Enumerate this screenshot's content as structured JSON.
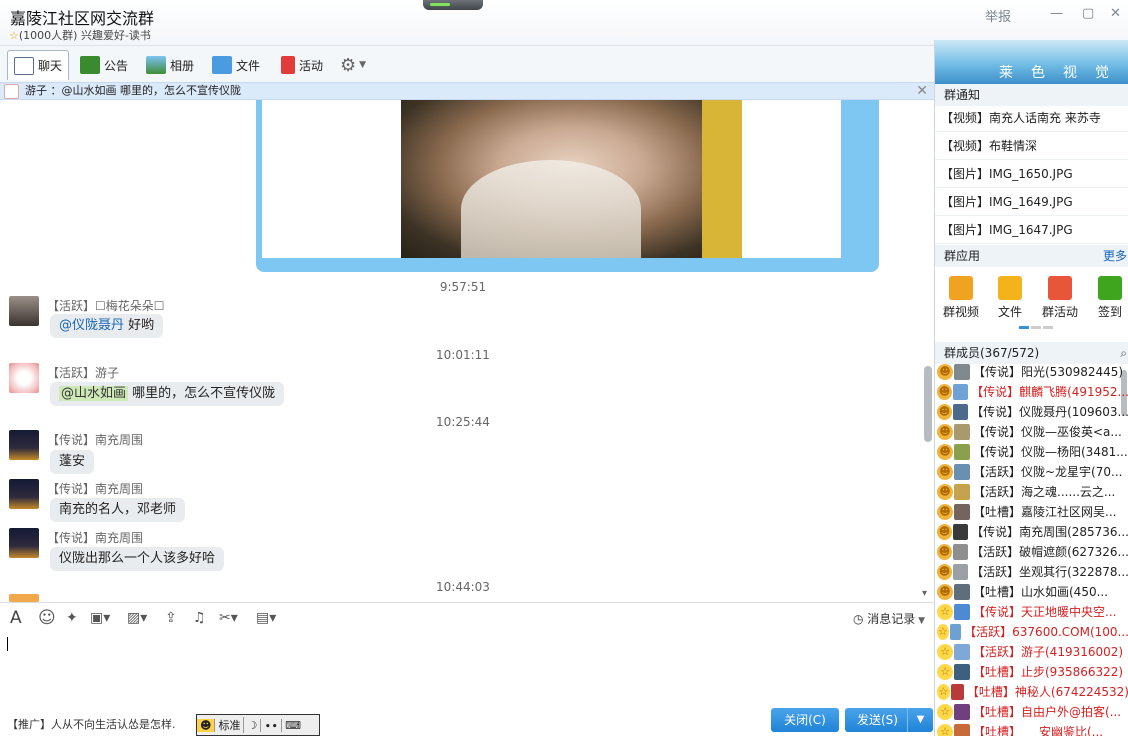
{
  "window": {
    "title": "嘉陵江社区网交流群",
    "subtitle_star": "☆",
    "subtitle": "(1000人群) 兴趣爱好-读书",
    "report": "举报",
    "min": "—",
    "max": "▢",
    "close": "✕"
  },
  "tabs": [
    {
      "label": "聊天"
    },
    {
      "label": "公告"
    },
    {
      "label": "相册"
    },
    {
      "label": "文件"
    },
    {
      "label": "活动"
    }
  ],
  "notice": {
    "text": "游子 ：@山水如画 哪里的，怎么不宣传仪陇",
    "close": "✕"
  },
  "chat": {
    "times": [
      "9:57:51",
      "10:01:11",
      "10:25:44",
      "10:44:03"
    ],
    "messages": [
      {
        "nick": "【活跃】☐梅花朵朵☐",
        "at": "@仪陇聂丹",
        "text": " 好哟"
      },
      {
        "nick": "【活跃】游子",
        "at": "@山水如画",
        "text": " 哪里的，怎么不宣传仪陇"
      },
      {
        "nick": "【传说】南充周围",
        "text": "蓬安"
      },
      {
        "nick": "【传说】南充周围",
        "text": "南充的名人，邓老师"
      },
      {
        "nick": "【传说】南充周围",
        "text": "仪陇出那么一个人该多好哈"
      }
    ]
  },
  "input": {
    "history": "消息记录",
    "font": "A",
    "emoji": "☺"
  },
  "bottom": {
    "promo": "【推广】人从不向生活认怂是怎样.",
    "ime": [
      "标准",
      "☽",
      "∙∙",
      "⌨"
    ],
    "close": "关闭(C)",
    "send": "发送(S)",
    "send_dd": "▼"
  },
  "sidebar": {
    "banner": "莱色视觉",
    "notice_title": "群通知",
    "notices": [
      "【视频】南充人话南充 来苏寺",
      "【视频】布鞋情深",
      "【图片】IMG_1650.JPG",
      "【图片】IMG_1649.JPG",
      "【图片】IMG_1647.JPG"
    ],
    "apps_title": "群应用",
    "apps_more": "更多",
    "apps": [
      {
        "label": "群视频",
        "color": "#f0a320"
      },
      {
        "label": "文件",
        "color": "#f4b21c"
      },
      {
        "label": "群活动",
        "color": "#e8563a"
      },
      {
        "label": "签到",
        "color": "#3fa51f"
      }
    ],
    "members_title": "群成员(367/572)",
    "members": [
      {
        "name": "【传说】阳光(530982445)",
        "color": "#222"
      },
      {
        "name": "【传说】麒麟飞腾(491952...",
        "color": "#d42020"
      },
      {
        "name": "【传说】仪陇聂丹(109603...",
        "color": "#222"
      },
      {
        "name": "【传说】仪陇—巫俊英<a...",
        "color": "#222"
      },
      {
        "name": "【传说】仪陇—杨阳(3481...",
        "color": "#222"
      },
      {
        "name": "【活跃】仪陇~龙星宇(70...",
        "color": "#222"
      },
      {
        "name": "【活跃】海之魂......云之...",
        "color": "#222"
      },
      {
        "name": "【吐槽】嘉陵江社区网吴...",
        "color": "#222"
      },
      {
        "name": "【传说】南充周围(285736...",
        "color": "#222"
      },
      {
        "name": "【活跃】破帽遮颜(627326...",
        "color": "#222"
      },
      {
        "name": "【活跃】坐观其行(322878...",
        "color": "#222"
      },
      {
        "name": "【吐槽】山水如画(450...",
        "color": "#222"
      },
      {
        "name": "【传说】天正地暖中央空...",
        "color": "#d42020"
      },
      {
        "name": "【活跃】637600.COM(100...",
        "color": "#d42020"
      },
      {
        "name": "【活跃】游子(419316002)",
        "color": "#d42020"
      },
      {
        "name": "【吐槽】止步(935866322)",
        "color": "#d42020"
      },
      {
        "name": "【吐槽】神秘人(674224532)",
        "color": "#d42020"
      },
      {
        "name": "【吐槽】自由户外@拍客(...",
        "color": "#d42020"
      },
      {
        "name": "【吐槽】　　安幽鉴比(...",
        "color": "#d42020"
      }
    ]
  }
}
